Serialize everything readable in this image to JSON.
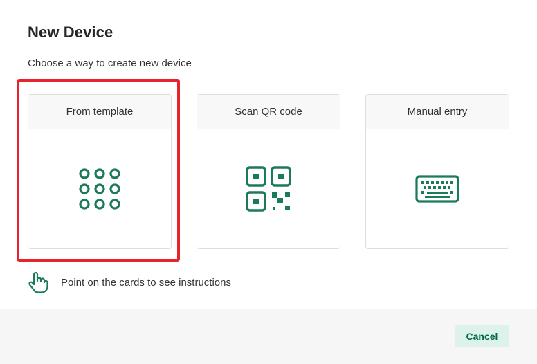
{
  "dialog": {
    "title": "New Device",
    "subtitle": "Choose a way to create new device"
  },
  "cards": [
    {
      "label": "From template",
      "icon": "grid-dots-icon"
    },
    {
      "label": "Scan QR code",
      "icon": "qr-code-icon"
    },
    {
      "label": "Manual entry",
      "icon": "keyboard-icon"
    }
  ],
  "hint": {
    "icon": "pointing-hand-icon",
    "text": "Point on the cards to see instructions"
  },
  "footer": {
    "cancel_label": "Cancel"
  },
  "colors": {
    "accent": "#1b7a58",
    "highlight": "#e8232b",
    "cancel_bg": "#dcf2ea",
    "cancel_text": "#00684a"
  }
}
